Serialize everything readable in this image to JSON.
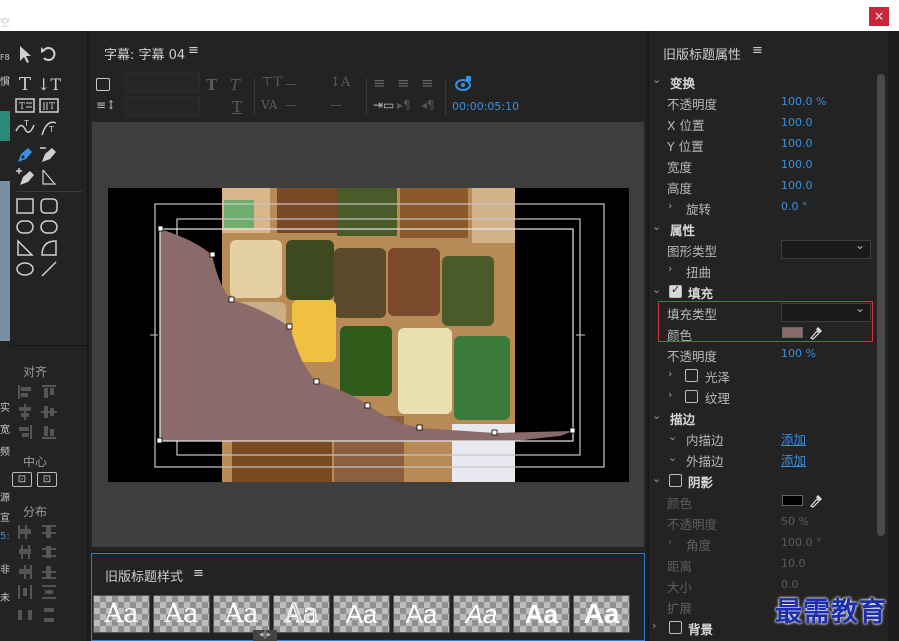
{
  "window": {
    "close_label": "×",
    "left_clipped_chars": [
      "空",
      "F8",
      "慣",
      "实",
      "宽",
      "频",
      "源",
      "宣",
      "5:",
      "非",
      "未"
    ]
  },
  "tools_panel": {
    "align_label": "对齐",
    "center_label": "中心",
    "distribute_label": "分布",
    "tools": [
      "selection-tool",
      "rotate-tool",
      "type-tool",
      "vertical-type-tool",
      "area-type-tool",
      "vertical-area-type-tool",
      "path-type-tool",
      "vertical-path-type-tool",
      "pen-tool",
      "delete-anchor-tool",
      "add-anchor-tool",
      "convert-anchor-tool",
      "rectangle-tool",
      "rounded-rect-tool",
      "clipped-corner-tool",
      "rounded-corner-tool",
      "wedge-tool",
      "arc-tool",
      "ellipse-tool",
      "line-tool"
    ]
  },
  "title_panel": {
    "tab_title": "字幕: 字幕 04",
    "menu_icon": "≡",
    "timecode": "00:00:05:10"
  },
  "styles_panel": {
    "title": "旧版标题样式",
    "menu_icon": "≡",
    "swatches": [
      "Aa",
      "Aa",
      "Aa",
      "Aa",
      "Aa",
      "Aa",
      "Aa",
      "Aa",
      "Aa"
    ]
  },
  "properties_panel": {
    "title": "旧版标题属性",
    "menu_icon": "≡",
    "transform": {
      "header": "变换",
      "opacity_label": "不透明度",
      "opacity_value": "100.0 %",
      "x_label": "X 位置",
      "x_value": "100.0",
      "y_label": "Y 位置",
      "y_value": "100.0",
      "width_label": "宽度",
      "width_value": "100.0",
      "height_label": "高度",
      "height_value": "100.0",
      "rotation_label": "旋转",
      "rotation_value": "0.0 °"
    },
    "properties": {
      "header": "属性",
      "shape_type_label": "图形类型",
      "distort_label": "扭曲"
    },
    "fill": {
      "header": "填充",
      "fill_type_label": "填充类型",
      "color_label": "颜色",
      "color_hex": "#8a6a6a",
      "opacity_label": "不透明度",
      "opacity_value": "100 %",
      "sheen_label": "光泽",
      "texture_label": "纹理"
    },
    "stroke": {
      "header": "描边",
      "inner_label": "内描边",
      "inner_action": "添加",
      "outer_label": "外描边",
      "outer_action": "添加"
    },
    "shadow": {
      "header": "阴影",
      "color_label": "颜色",
      "color_hex": "#000000",
      "opacity_label": "不透明度",
      "opacity_value": "50 %",
      "angle_label": "角度",
      "angle_value": "100.0 °",
      "distance_label": "距离",
      "distance_value": "10.0",
      "size_label": "大小",
      "size_value": "0.0",
      "spread_label": "扩展"
    },
    "background": {
      "header": "背景"
    }
  },
  "watermark": "最需教育",
  "colors": {
    "accent_blue": "#3a90e0",
    "highlight_red": "#d1343d",
    "shape_fill": "#8a6a6a"
  }
}
